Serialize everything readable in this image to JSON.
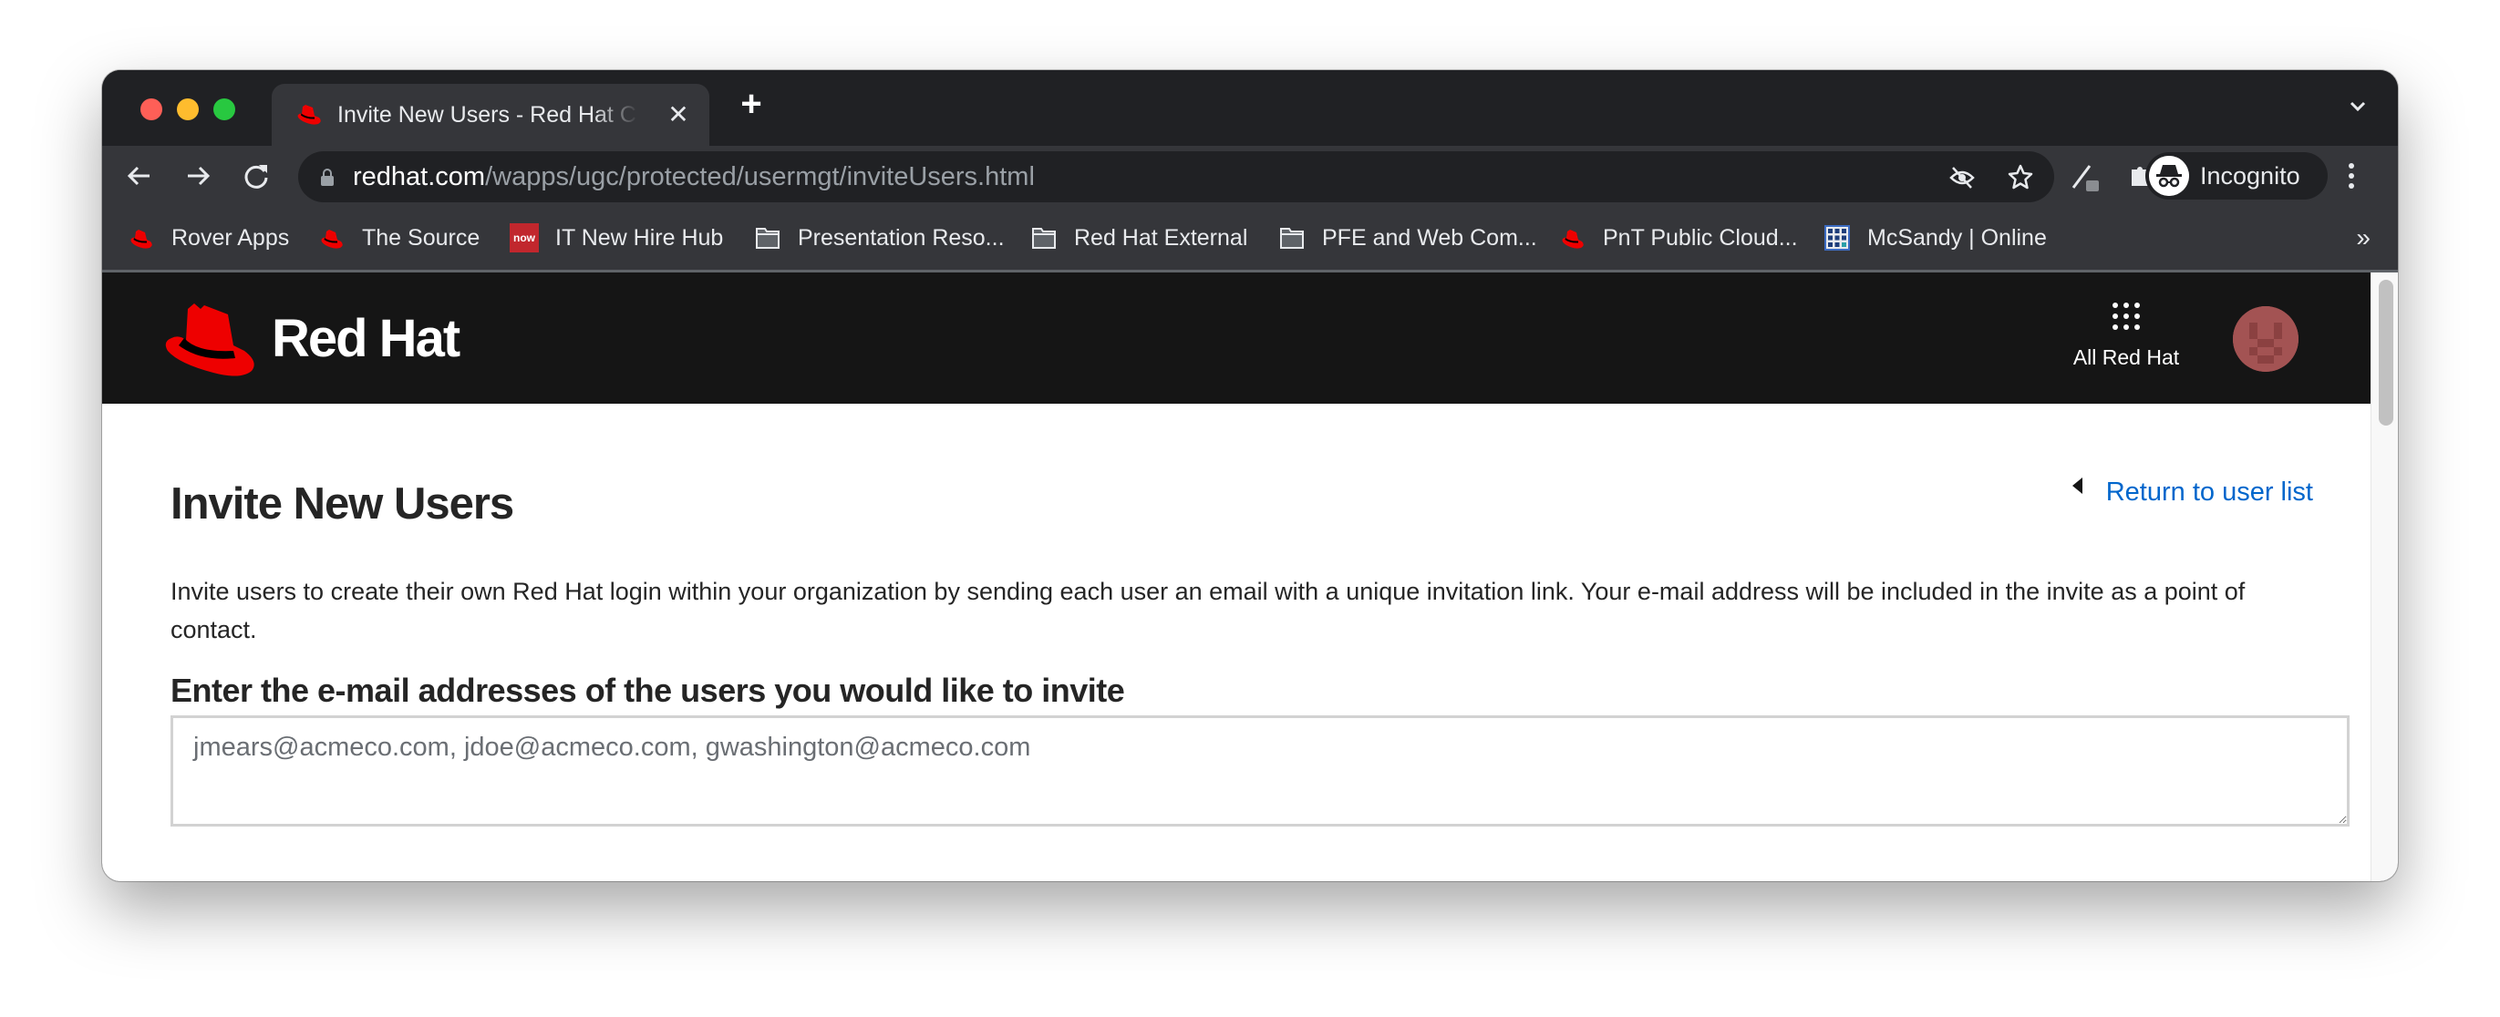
{
  "browser": {
    "tab": {
      "title": "Invite New Users - Red Hat Customer Portal",
      "favicon": "redhat-hat-icon"
    },
    "new_tab_label": "+",
    "url": {
      "host": "redhat.com",
      "path": "/wapps/ugc/protected/usermgt/inviteUsers.html"
    },
    "profile_label": "Incognito",
    "bookmarks": [
      {
        "label": "Rover Apps",
        "icon": "redhat-hat-icon"
      },
      {
        "label": "The Source",
        "icon": "redhat-hat-icon"
      },
      {
        "label": "IT New Hire Hub",
        "icon": "servicenow-icon",
        "icon_text": "now"
      },
      {
        "label": "Presentation Reso...",
        "icon": "folder-icon"
      },
      {
        "label": "Red Hat External",
        "icon": "folder-icon"
      },
      {
        "label": "PFE and Web Com...",
        "icon": "folder-icon"
      },
      {
        "label": "PnT Public Cloud...",
        "icon": "redhat-hat-icon"
      },
      {
        "label": "McSandy | Online",
        "icon": "building-grid-icon"
      }
    ],
    "bookmarks_overflow": "»"
  },
  "site_header": {
    "brand": "Red Hat",
    "all_red_hat_label": "All Red Hat"
  },
  "main": {
    "title": "Invite New Users",
    "return_link": "Return to user list",
    "description": "Invite users to create their own Red Hat login within your organization by sending each user an email with a unique invitation link. Your e-mail address will be included in the invite as a point of contact.",
    "emails_label": "Enter the e-mail addresses of the users you would like to invite",
    "emails_value": "",
    "emails_placeholder": "jmears@acmeco.com, jdoe@acmeco.com, gwashington@acmeco.com"
  },
  "colors": {
    "brand_red": "#ee0000",
    "link_blue": "#0066cc",
    "header_bg": "#151515"
  }
}
